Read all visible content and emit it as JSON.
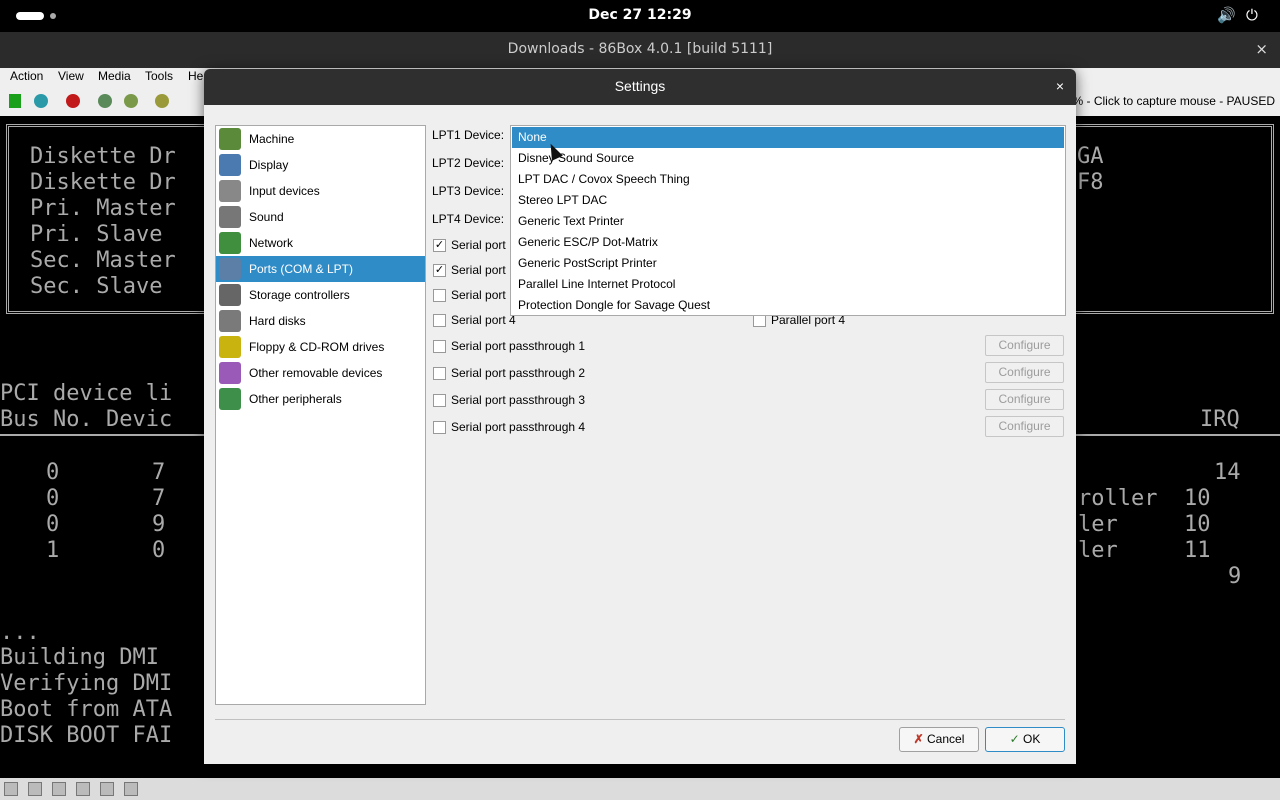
{
  "topbar": {
    "clock": "Dec 27  12:29",
    "volume_icon": "🔊",
    "power_icon": "⏻"
  },
  "window": {
    "title": "Downloads - 86Box 4.0.1 [build 5111]",
    "close_icon": "×"
  },
  "menubar": {
    "items": [
      "Action",
      "View",
      "Media",
      "Tools",
      "He"
    ]
  },
  "toolbar": {
    "status": "% - Click to capture mouse - PAUSED"
  },
  "screen": {
    "lines": [
      "Diskette Dr",
      "Diskette Dr",
      "Pri. Master",
      "Pri. Slave",
      "Sec. Master",
      "Sec. Slave",
      "GA",
      "F8",
      "PCI device li",
      "Bus No. Devic",
      "IRQ",
      "0       7",
      "0       7",
      "0       9",
      "1       0",
      "14",
      "roller  10",
      "ler     10",
      "ler     11",
      "9",
      "...",
      "Building DMI",
      "Verifying DMI",
      "Boot from ATA",
      "DISK BOOT FAI"
    ]
  },
  "dialog": {
    "title": "Settings",
    "close_icon": "×",
    "nav": [
      {
        "label": "Machine",
        "icon": "motherboard-icon",
        "color": "#5a8a3a"
      },
      {
        "label": "Display",
        "icon": "monitor-icon",
        "color": "#4a7ab0"
      },
      {
        "label": "Input devices",
        "icon": "keyboard-icon",
        "color": "#888888"
      },
      {
        "label": "Sound",
        "icon": "speaker-icon",
        "color": "#777777"
      },
      {
        "label": "Network",
        "icon": "network-icon",
        "color": "#3f8f3f"
      },
      {
        "label": "Ports (COM & LPT)",
        "icon": "ports-icon",
        "color": "#5c7fa8"
      },
      {
        "label": "Storage controllers",
        "icon": "storage-icon",
        "color": "#666666"
      },
      {
        "label": "Hard disks",
        "icon": "hdd-icon",
        "color": "#7a7a7a"
      },
      {
        "label": "Floppy & CD-ROM drives",
        "icon": "floppy-cdrom-icon",
        "color": "#c9b30e"
      },
      {
        "label": "Other removable devices",
        "icon": "removable-icon",
        "color": "#9a5ab8"
      },
      {
        "label": "Other peripherals",
        "icon": "peripherals-icon",
        "color": "#3e8f4a"
      }
    ],
    "selected_nav": 5,
    "lpt_labels": [
      "LPT1 Device:",
      "LPT2 Device:",
      "LPT3 Device:",
      "LPT4 Device:"
    ],
    "serial_ports": [
      {
        "label": "Serial port",
        "checked": true
      },
      {
        "label": "Serial port",
        "checked": true
      },
      {
        "label": "Serial port",
        "checked": false
      },
      {
        "label": "Serial port 4",
        "checked": false
      }
    ],
    "parallel_port4": {
      "label": "Parallel port 4",
      "checked": false
    },
    "passthrough": [
      {
        "label": "Serial port passthrough 1",
        "button": "Configure"
      },
      {
        "label": "Serial port passthrough 2",
        "button": "Configure"
      },
      {
        "label": "Serial port passthrough 3",
        "button": "Configure"
      },
      {
        "label": "Serial port passthrough 4",
        "button": "Configure"
      }
    ],
    "dropdown_options": [
      "None",
      "Disney Sound Source",
      "LPT DAC / Covox Speech Thing",
      "Stereo LPT DAC",
      "Generic Text Printer",
      "Generic ESC/P Dot-Matrix",
      "Generic PostScript Printer",
      "Parallel Line Internet Protocol",
      "Protection Dongle for Savage Quest"
    ],
    "dropdown_selected": 0,
    "cancel_label": "Cancel",
    "ok_label": "OK"
  },
  "colors": {
    "accent": "#308cc6",
    "dialog_bg": "#efefef"
  }
}
